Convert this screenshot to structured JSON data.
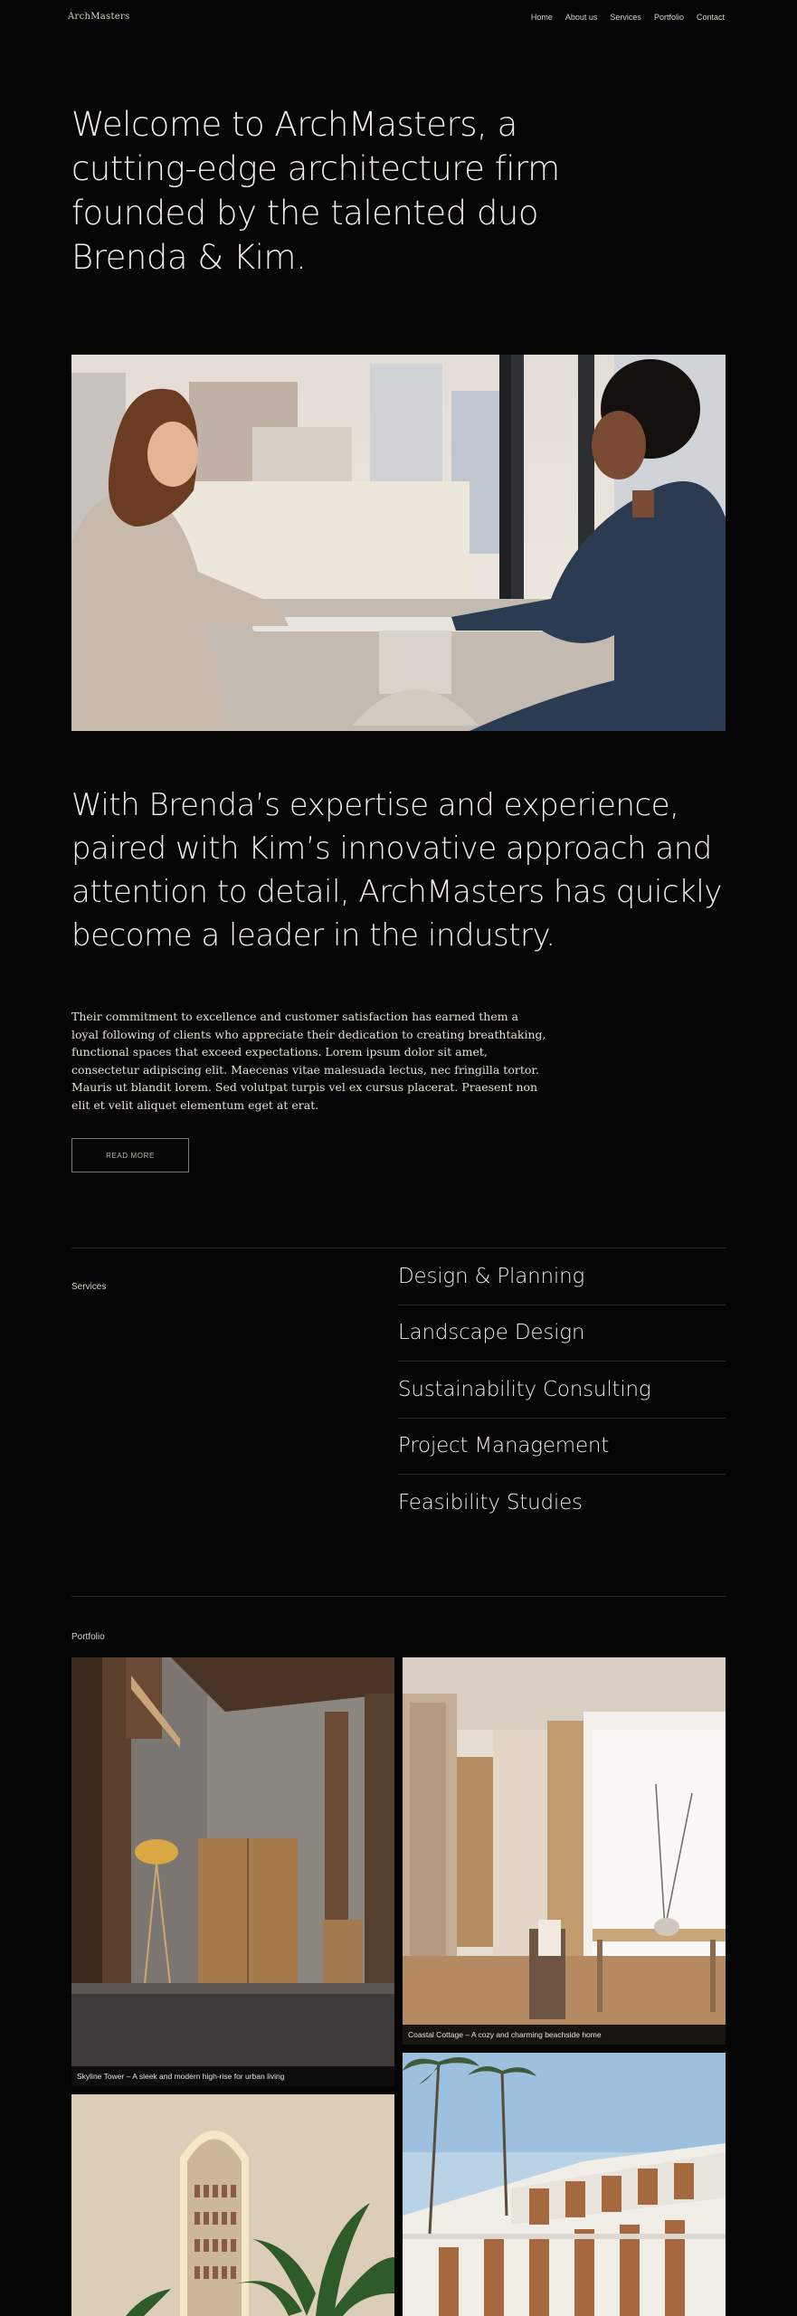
{
  "brand": {
    "logo": "ArchMasters"
  },
  "nav": {
    "items": [
      "Home",
      "About us",
      "Services",
      "Portfolio",
      "Contact"
    ]
  },
  "hero": {
    "headline": "Welcome to ArchMasters, a cutting-edge architecture firm founded by the talented duo Brenda & Kim."
  },
  "about": {
    "statement": "With Brenda’s expertise and experience, paired with Kim’s innovative approach and attention to detail, ArchMasters has quickly become a leader in the industry.",
    "body": "Their commitment to excellence and customer satisfaction has earned them a loyal following of clients who appreciate their dedication to creating breathtaking, functional spaces that exceed expectations. Lorem ipsum dolor sit amet, consectetur adipiscing elit. Maecenas vitae malesuada lectus, nec fringilla tortor. Mauris ut blandit lorem. Sed volutpat turpis vel ex cursus placerat. Praesent non elit et velit aliquet elementum eget at erat.",
    "cta_label": "READ MORE"
  },
  "services": {
    "label": "Services",
    "items": [
      "Design & Planning",
      "Landscape Design",
      "Sustainability Consulting",
      "Project Management",
      "Feasibility Studies"
    ]
  },
  "portfolio": {
    "label": "Portfolio",
    "items": [
      {
        "caption": "Skyline Tower – A sleek and modern high-rise for urban living"
      },
      {
        "caption": "Coastal Cottage – A cozy and charming beachside home"
      },
      {
        "caption": ""
      },
      {
        "caption": ""
      }
    ]
  },
  "colors": {
    "background": "#050505",
    "text": "#efe9e0",
    "divider": "#2a2a2a"
  }
}
